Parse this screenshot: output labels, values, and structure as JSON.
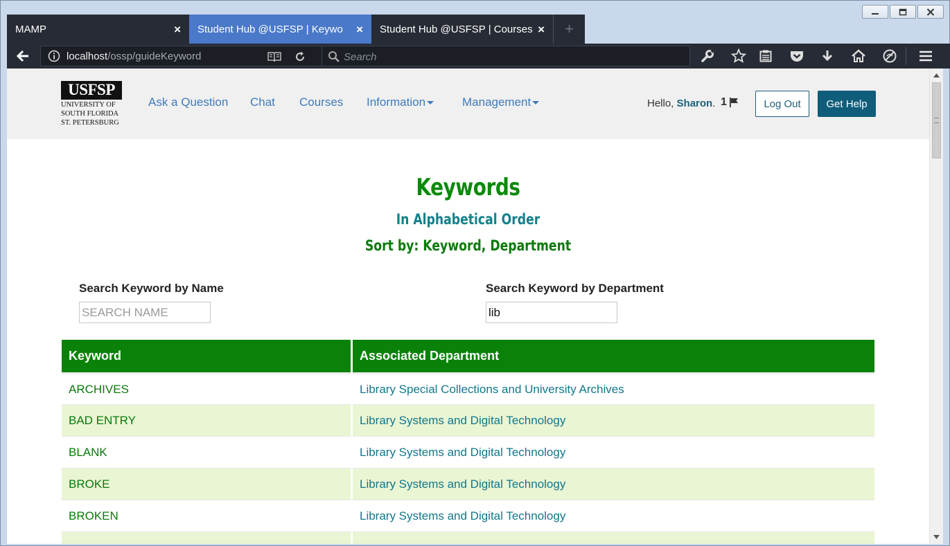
{
  "browser": {
    "tabs": [
      {
        "label": "MAMP",
        "active": false
      },
      {
        "label": "Student Hub @USFSP | Keyword G",
        "active": true
      },
      {
        "label": "Student Hub @USFSP | Courses",
        "active": false
      }
    ],
    "url_host": "localhost",
    "url_path": "/ossp/guideKeyword",
    "search_placeholder": "Search",
    "icons": [
      "back-arrow-icon",
      "info-icon",
      "reader-view-icon",
      "reload-icon",
      "search-icon",
      "wrench-icon",
      "star-icon",
      "clipboard-icon",
      "pocket-icon",
      "download-icon",
      "home-icon",
      "no-tracking-icon",
      "menu-icon"
    ],
    "accent_color": "#4a79c9"
  },
  "site": {
    "logo_mark": "USFSP",
    "logo_lines": [
      "UNIVERSITY OF",
      "SOUTH FLORIDA",
      "ST. PETERSBURG"
    ],
    "nav": {
      "ask": "Ask a Question",
      "chat": "Chat",
      "courses": "Courses",
      "information": "Information",
      "management": "Management"
    },
    "greeting_prefix": "Hello,",
    "user_name": "Sharon",
    "flag_count": "1",
    "logout_label": "Log Out",
    "help_label": "Get Help",
    "brand_color": "#0f5d7a"
  },
  "main": {
    "title": "Keywords",
    "subtitle": "In Alphabetical Order",
    "sort_text": "Sort by: Keyword, Department",
    "search_name_label": "Search Keyword by Name",
    "search_name_placeholder": "SEARCH NAME",
    "search_name_value": "",
    "search_dept_label": "Search Keyword by Department",
    "search_dept_value": "lib",
    "table": {
      "headers": [
        "Keyword",
        "Associated Department"
      ],
      "rows": [
        [
          "ARCHIVES",
          "Library Special Collections and University Archives"
        ],
        [
          "BAD ENTRY",
          "Library Systems and Digital Technology"
        ],
        [
          "BLANK",
          "Library Systems and Digital Technology"
        ],
        [
          "BROKE",
          "Library Systems and Digital Technology"
        ],
        [
          "BROKEN",
          "Library Systems and Digital Technology"
        ],
        [
          "",
          ""
        ]
      ]
    },
    "header_color": "#0a820a",
    "stripe_color": "#eaf5d3"
  }
}
